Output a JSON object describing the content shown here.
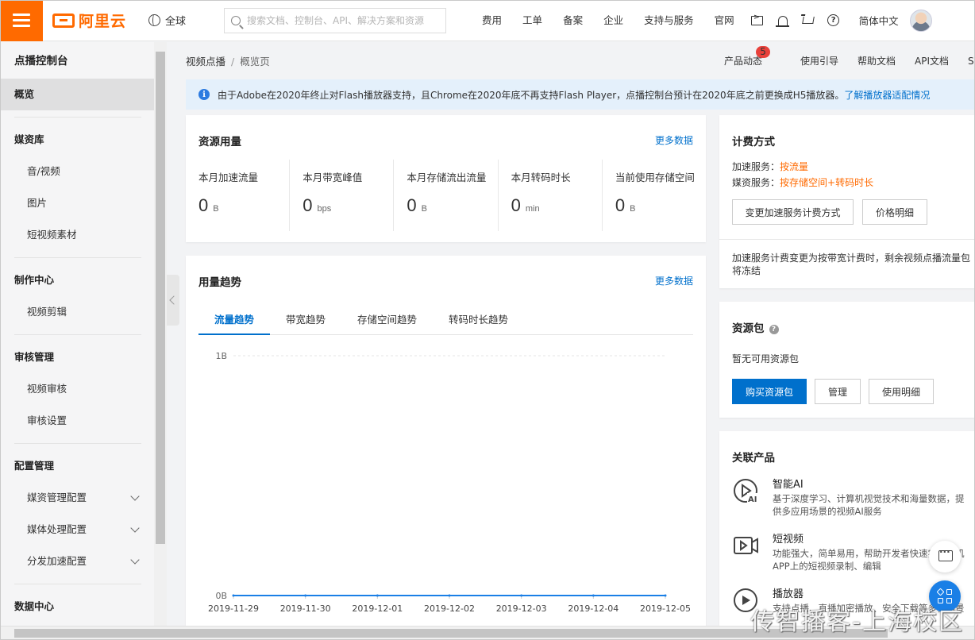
{
  "topbar": {
    "brand": "阿里云",
    "region": "全球",
    "search_placeholder": "搜索文档、控制台、API、解决方案和资源",
    "nav": [
      "费用",
      "工单",
      "备案",
      "企业",
      "支持与服务",
      "官网"
    ],
    "language": "简体中文",
    "icons": [
      "terminal-icon",
      "bell-icon",
      "cart-icon",
      "help-icon"
    ]
  },
  "sidebar": {
    "title": "点播控制台",
    "active_item": "概览",
    "groups": [
      {
        "label": "媒资库",
        "items": [
          "音/视频",
          "图片",
          "短视频素材"
        ]
      },
      {
        "label": "制作中心",
        "items": [
          "视频剪辑"
        ]
      },
      {
        "label": "审核管理",
        "items": [
          "视频审核",
          "审核设置"
        ]
      },
      {
        "label": "配置管理",
        "items": [
          "媒资管理配置",
          "媒体处理配置",
          "分发加速配置"
        ]
      },
      {
        "label": "数据中心",
        "items": []
      }
    ]
  },
  "breadcrumb": {
    "root": "视频点播",
    "sep": "/",
    "current": "概览页"
  },
  "help_links": {
    "product_news": "产品动态",
    "news_badge": "5",
    "guide": "使用引导",
    "help_doc": "帮助文档",
    "api_doc": "API文档",
    "sdk_doc": "SDK文"
  },
  "notice": {
    "text": "由于Adobe在2020年终止对Flash播放器支持，且Chrome在2020年底不再支持Flash Player，点播控制台预计在2020年底之前更换成H5播放器。",
    "link": "了解播放器适配情况"
  },
  "usage": {
    "title": "资源用量",
    "more": "更多数据",
    "metrics": [
      {
        "label": "本月加速流量",
        "value": "0",
        "unit": "B"
      },
      {
        "label": "本月带宽峰值",
        "value": "0",
        "unit": "bps"
      },
      {
        "label": "本月存储流出流量",
        "value": "0",
        "unit": "B"
      },
      {
        "label": "本月转码时长",
        "value": "0",
        "unit": "min"
      },
      {
        "label": "当前使用存储空间",
        "value": "0",
        "unit": "B"
      }
    ]
  },
  "trend": {
    "title": "用量趋势",
    "more": "更多数据",
    "tabs": [
      "流量趋势",
      "带宽趋势",
      "存储空间趋势",
      "转码时长趋势"
    ],
    "active_tab": "流量趋势"
  },
  "chart_data": {
    "type": "line",
    "x": [
      "2019-11-29",
      "2019-11-30",
      "2019-12-01",
      "2019-12-02",
      "2019-12-03",
      "2019-12-04",
      "2019-12-05"
    ],
    "series": [
      {
        "values": [
          0,
          0,
          0,
          0,
          0,
          0,
          0
        ]
      }
    ],
    "y_ticks": [
      "0B",
      "1B"
    ],
    "ylim": [
      0,
      1
    ],
    "line_color": "#1a7fe6",
    "grid": true
  },
  "billing": {
    "title": "计费方式",
    "accel_label": "加速服务：",
    "accel_value": "按流量",
    "media_label": "媒资服务：",
    "media_value": "按存储空间+转码时长",
    "change_btn": "变更加速服务计费方式",
    "price_btn": "价格明细",
    "note": "加速服务计费变更为按带宽计费时，剩余视频点播流量包将冻结"
  },
  "resource_pack": {
    "title": "资源包",
    "empty": "暂无可用资源包",
    "buy_btn": "购买资源包",
    "manage_btn": "管理",
    "detail_btn": "使用明细"
  },
  "related": {
    "title": "关联产品",
    "products": [
      {
        "name": "智能AI",
        "desc1": "基于深度学习、计算机视觉技术和海量数据，提",
        "desc2": "供多应用场景的视频AI服务"
      },
      {
        "name": "短视频",
        "desc1": "功能强大，简单易用，帮助开发者快速实现手机",
        "desc2": "APP上的短视频录制、编辑"
      },
      {
        "name": "播放器",
        "desc1": "支持点播、直播加密播放、安全下载等多种场景",
        "desc2": ""
      }
    ]
  },
  "watermark": "传智播客-上海校区",
  "colors": {
    "brand": "#ff6a00",
    "link": "#0070cc",
    "accent_blue": "#1a7fe6",
    "badge": "#e8413b"
  }
}
